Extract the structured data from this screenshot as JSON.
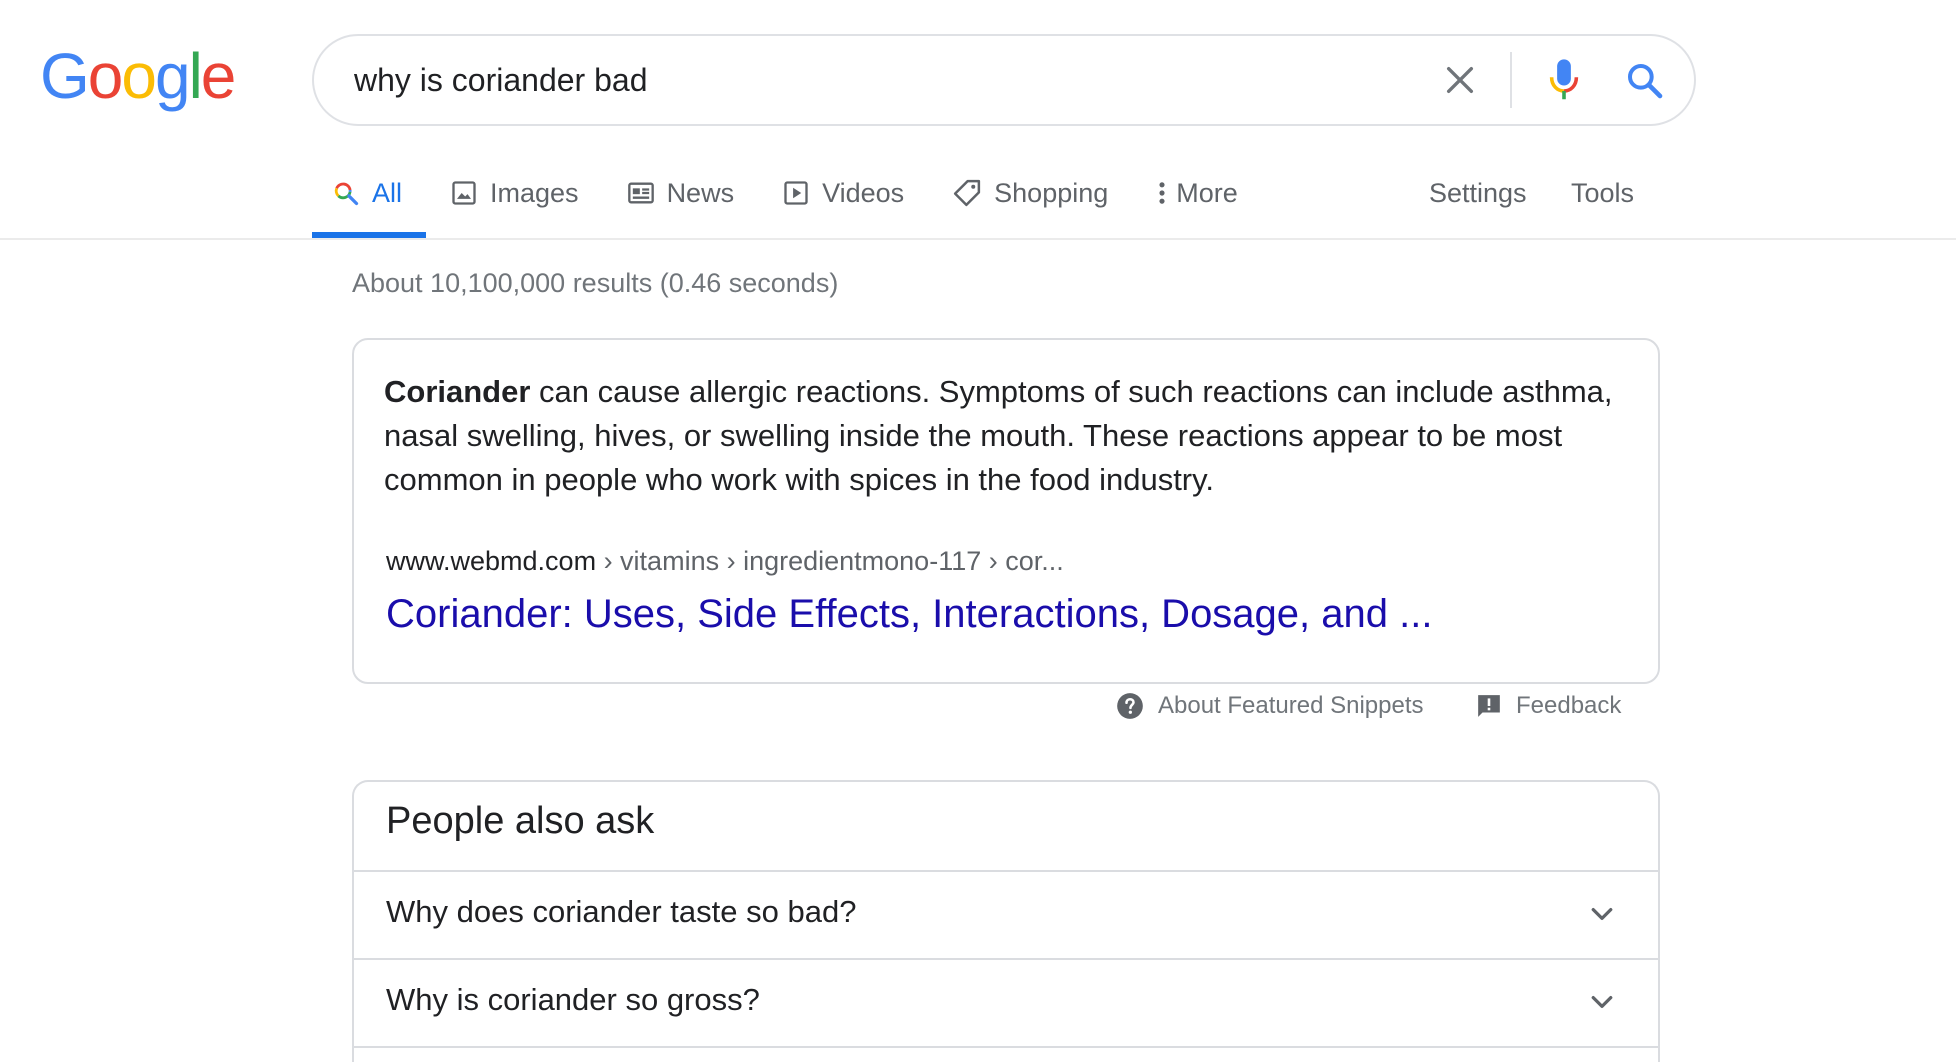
{
  "logo": {
    "letters": [
      "G",
      "o",
      "o",
      "g",
      "l",
      "e"
    ],
    "colors": [
      "#4285F4",
      "#EA4335",
      "#FBBC05",
      "#4285F4",
      "#34A853",
      "#EA4335"
    ]
  },
  "search": {
    "value": "why is coriander bad",
    "clear_icon": "close-icon",
    "mic_icon": "microphone-icon",
    "search_icon": "search-icon"
  },
  "tabs": [
    {
      "label": "All",
      "icon": "search-icon",
      "active": true
    },
    {
      "label": "Images",
      "icon": "image-icon"
    },
    {
      "label": "News",
      "icon": "newspaper-icon"
    },
    {
      "label": "Videos",
      "icon": "play-icon"
    },
    {
      "label": "Shopping",
      "icon": "tag-icon"
    },
    {
      "label": "More",
      "icon": "more-vert-icon"
    }
  ],
  "tabs_right": {
    "settings": "Settings",
    "tools": "Tools"
  },
  "stats": "About 10,100,000 results (0.46 seconds)",
  "snippet": {
    "bold": "Coriander",
    "text": " can cause allergic reactions. Symptoms of such reactions can include asthma, nasal swelling, hives, or swelling inside the mouth. These reactions appear to be most common in people who work with spices in the food industry.",
    "cite_host": "www.webmd.com",
    "cite_path": " › vitamins › ingredientmono-117 › cor...",
    "title": "Coriander: Uses, Side Effects, Interactions, Dosage, and ..."
  },
  "snippet_footer": {
    "about": "About Featured Snippets",
    "feedback": "Feedback"
  },
  "paa": {
    "title": "People also ask",
    "questions": [
      "Why does coriander taste so bad?",
      "Why is coriander so gross?"
    ]
  },
  "colors": {
    "accent": "#1a73e8",
    "link": "#1a0dab",
    "muted": "#70757a",
    "border": "#dadce0"
  }
}
